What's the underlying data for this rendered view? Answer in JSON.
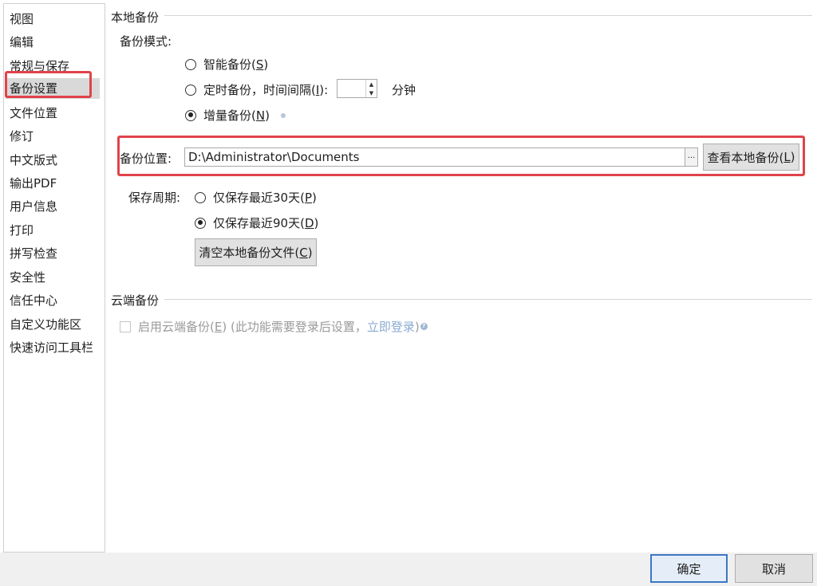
{
  "sidebar": {
    "items": [
      {
        "label": "视图"
      },
      {
        "label": "编辑"
      },
      {
        "label": "常规与保存"
      },
      {
        "label": "备份设置",
        "selected": true
      },
      {
        "label": "文件位置"
      },
      {
        "label": "修订"
      },
      {
        "label": "中文版式"
      },
      {
        "label": "输出PDF"
      },
      {
        "label": "用户信息"
      },
      {
        "label": "打印"
      },
      {
        "label": "拼写检查"
      },
      {
        "label": "安全性"
      },
      {
        "label": "信任中心"
      },
      {
        "label": "自定义功能区"
      },
      {
        "label": "快速访问工具栏"
      }
    ]
  },
  "local_backup": {
    "title": "本地备份",
    "mode_label": "备份模式:",
    "modes": [
      {
        "label": "智能备份(",
        "key": "S",
        "tail": ")",
        "checked": false
      },
      {
        "label": "定时备份，时间间隔(",
        "key": "I",
        "tail": "):",
        "checked": false
      },
      {
        "label": "增量备份(",
        "key": "N",
        "tail": ")",
        "checked": true
      }
    ],
    "interval_value": "",
    "interval_unit": "分钟",
    "location_label": "备份位置:",
    "location_value": "D:\\Administrator\\Documents",
    "browse_label": "...",
    "view_button": {
      "label": "查看本地备份(",
      "key": "L",
      "tail": ")"
    },
    "period_label": "保存周期:",
    "periods": [
      {
        "label": "仅保存最近30天(",
        "key": "P",
        "tail": ")",
        "checked": false
      },
      {
        "label": "仅保存最近90天(",
        "key": "D",
        "tail": ")",
        "checked": true
      }
    ],
    "clear_button": {
      "label": "清空本地备份文件(",
      "key": "C",
      "tail": ")"
    }
  },
  "cloud_backup": {
    "title": "云端备份",
    "enable_label": "启用云端备份(",
    "enable_key": "E",
    "enable_tail": ") (此功能需要登录后设置，",
    "login_link": "立即登录",
    "close_paren": ")",
    "enabled": false
  },
  "footer": {
    "ok_label": "确定",
    "cancel_label": "取消"
  },
  "colors": {
    "highlight": "#e0444a",
    "selected_bg": "#d9d9d9",
    "default_button_border": "#3b78c4",
    "link": "#8aaad3"
  }
}
